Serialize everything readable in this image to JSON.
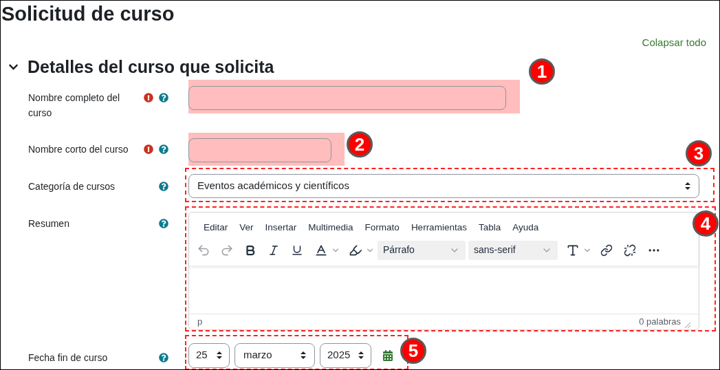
{
  "page": {
    "title": "Solicitud de curso",
    "collapse_all_link": "Colapsar todo"
  },
  "section": {
    "title": "Detalles del curso que solicita",
    "expanded": true
  },
  "fields": [
    {
      "kind": "text",
      "label": "Nombre completo del curso",
      "required": true,
      "help": true,
      "badge": "1"
    },
    {
      "kind": "text",
      "label": "Nombre corto del curso",
      "required": true,
      "help": true,
      "badge": "2"
    },
    {
      "kind": "select",
      "label": "Categoría de cursos",
      "required": false,
      "help": true,
      "value": "Eventos académicos y científicos",
      "badge": "3"
    },
    {
      "kind": "editor",
      "label": "Resumen",
      "required": false,
      "help": true,
      "menu": [
        "Editar",
        "Ver",
        "Insertar",
        "Multimedia",
        "Formato",
        "Herramientas",
        "Tabla",
        "Ayuda"
      ],
      "block_format": "Párrafo",
      "font_family": "sans-serif",
      "status_path": "p",
      "word_count": "0 palabras",
      "badge": "4"
    },
    {
      "kind": "date",
      "label": "Fecha fin de curso",
      "required": false,
      "help": true,
      "day": "25",
      "month": "marzo",
      "year": "2025",
      "badge": "5"
    }
  ]
}
